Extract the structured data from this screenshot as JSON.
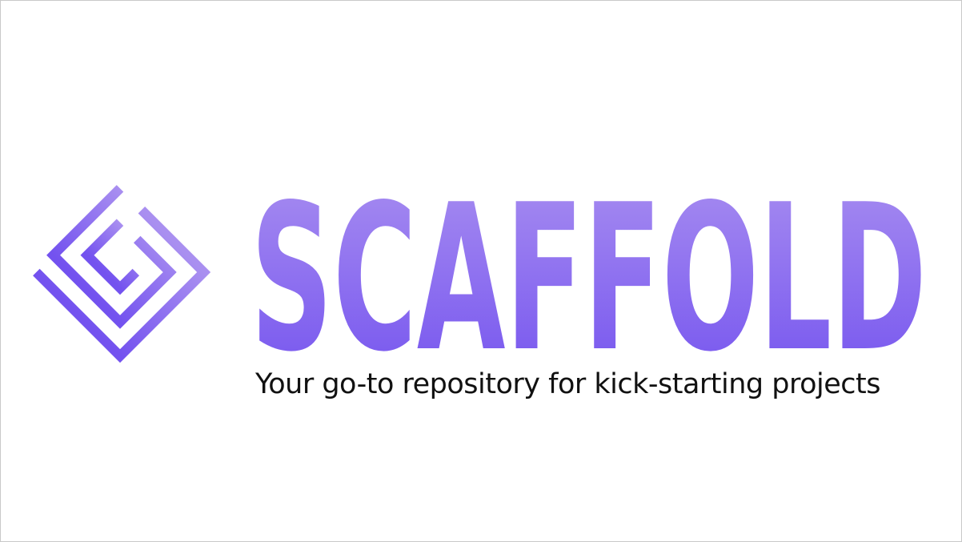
{
  "brand": {
    "name": "SCAFFOLD",
    "tagline": "Your go-to repository for kick-starting projects",
    "gradient_top": "#a98ff0",
    "gradient_bottom": "#7352ef",
    "logo_icon": "maze-s-diamond-icon"
  }
}
